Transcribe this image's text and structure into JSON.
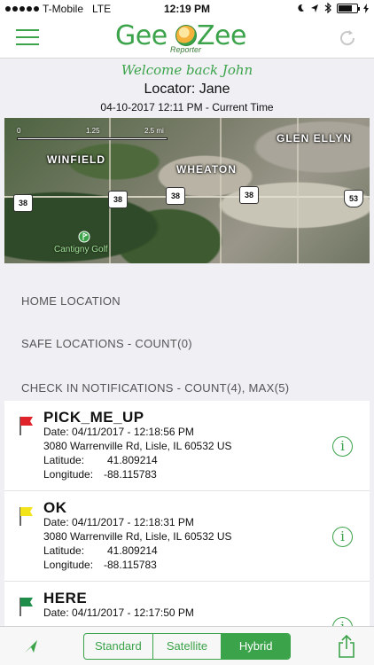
{
  "status_bar": {
    "carrier": "T-Mobile",
    "network": "LTE",
    "time": "12:19 PM",
    "battery_level": 0.7
  },
  "nav": {
    "logo_word_left": "Gee",
    "logo_word_right": "Zee",
    "logo_subtitle": "Reporter"
  },
  "header": {
    "welcome": "Welcome back John",
    "locator": "Locator: Jane",
    "timestamp": "04-10-2017 12:11 PM",
    "timestamp_suffix": " - Current Time"
  },
  "map": {
    "scale_labels": [
      "0",
      "1.25",
      "2.5 mi"
    ],
    "place_labels": [
      "Glen Ellyn",
      "Winfield",
      "Wheaton"
    ],
    "poi_label": "Cantigny Golf",
    "route_shields": [
      "38",
      "38",
      "38",
      "38",
      "53"
    ]
  },
  "sections": {
    "home": "HOME LOCATION",
    "safe": "SAFE LOCATIONS - COUNT(0)",
    "checkin": "CHECK IN NOTIFICATIONS - COUNT(4), MAX(5)"
  },
  "checkins": [
    {
      "title": "PICK_ME_UP",
      "flag_color": "#e0222a",
      "date": "Date: 04/11/2017 - 12:18:56 PM",
      "address": "3080 Warrenville Rd, Lisle, IL 60532 US",
      "latitude_label": "Latitude:",
      "latitude": "41.809214",
      "longitude_label": "Longitude:",
      "longitude": "-88.115783"
    },
    {
      "title": "OK",
      "flag_color": "#f2e31b",
      "date": "Date: 04/11/2017 - 12:18:31 PM",
      "address": "3080 Warrenville Rd, Lisle, IL 60532 US",
      "latitude_label": "Latitude:",
      "latitude": "41.809214",
      "longitude_label": "Longitude:",
      "longitude": "-88.115783"
    },
    {
      "title": "HERE",
      "flag_color": "#1f8c4a",
      "date": "Date: 04/11/2017 - 12:17:50 PM",
      "address": "",
      "latitude_label": "",
      "latitude": "",
      "longitude_label": "",
      "longitude": ""
    }
  ],
  "toolbar": {
    "map_types": [
      "Standard",
      "Satellite",
      "Hybrid"
    ],
    "selected": "Hybrid"
  },
  "colors": {
    "accent": "#3ba34a",
    "background": "#efeff4"
  },
  "icons": [
    "menu-icon",
    "refresh-icon",
    "info-icon",
    "location-arrow-icon",
    "share-icon",
    "flag-icon"
  ]
}
